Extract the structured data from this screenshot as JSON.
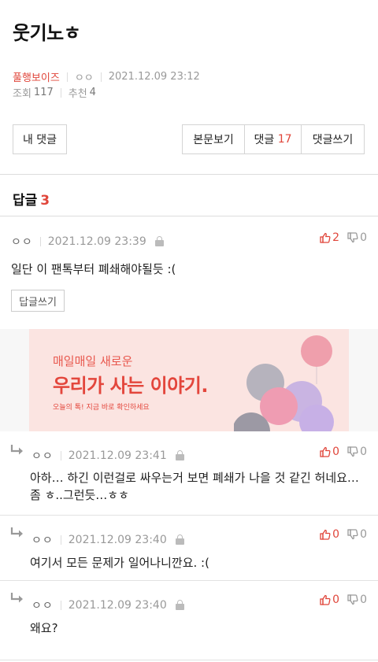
{
  "post": {
    "title": "웃기노ㅎ",
    "board": "풀행보이즈",
    "author": "ㅇㅇ",
    "datetime": "2021.12.09 23:12",
    "views_label": "조회",
    "views": "117",
    "recommend_label": "추천",
    "recommend": "4"
  },
  "buttons": {
    "my_comments": "내 댓글",
    "view_post": "본문보기",
    "comments_label": "댓글",
    "comments_count": "17",
    "write_comment": "댓글쓰기"
  },
  "replies": {
    "label": "답글",
    "count": "3"
  },
  "reply_button": "답글쓰기",
  "ad": {
    "line1": "매일매일 새로운",
    "line2": "우리가 사는 이야기.",
    "line3": "오늘의 톡! 지금 바로 확인하세요"
  },
  "comments": [
    {
      "author": "ㅇㅇ",
      "date": "2021.12.09 23:39",
      "likes": "2",
      "dislikes": "0",
      "text": "일단 이 팬톡부터 폐쇄해야될듯 :("
    },
    {
      "author": "ㅇㅇ",
      "date": "2021.12.09 23:41",
      "likes": "0",
      "dislikes": "0",
      "text1": "아하… 하긴 이런걸로 싸우는거 보면 폐쇄가 나을 것 같긴 허네요…",
      "text2": "좀 ㅎ..그런듯…ㅎㅎ"
    },
    {
      "author": "ㅇㅇ",
      "date": "2021.12.09 23:40",
      "likes": "0",
      "dislikes": "0",
      "text": "여기서 모든 문제가 일어나니깐요. :("
    },
    {
      "author": "ㅇㅇ",
      "date": "2021.12.09 23:40",
      "likes": "0",
      "dislikes": "0",
      "text": "왜요?"
    }
  ],
  "colors": {
    "accent": "#e0453a",
    "ad_bg": "#fbe4e1"
  }
}
